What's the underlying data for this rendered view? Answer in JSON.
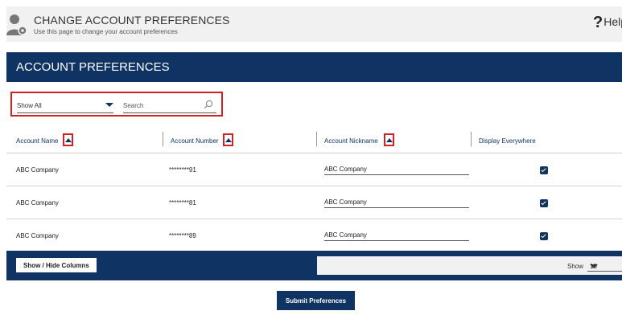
{
  "header": {
    "title": "CHANGE ACCOUNT PREFERENCES",
    "subtitle": "Use this page to change your account preferences",
    "help_label": "Help",
    "help_glyph": "?",
    "icon": "user-gear-icon"
  },
  "panel": {
    "title": "ACCOUNT PREFERENCES"
  },
  "filter": {
    "selected": "Show All",
    "search_placeholder": "Search"
  },
  "columns": {
    "name": "Account Name",
    "number": "Account Number",
    "nickname": "Account Nickname",
    "display": "Display Everywhere"
  },
  "rows": [
    {
      "name": "ABC Company",
      "number": "********91",
      "nickname": "ABC Company",
      "display": true
    },
    {
      "name": "ABC Company",
      "number": "********81",
      "nickname": "ABC Company",
      "display": true
    },
    {
      "name": "ABC Company",
      "number": "********89",
      "nickname": "ABC Company",
      "display": true
    }
  ],
  "footer": {
    "show_hide_label": "Show / Hide Columns",
    "show_label": "Show",
    "page_size": "10"
  },
  "submit_label": "Submit Preferences",
  "colors": {
    "navy": "#0f3362",
    "highlight_red": "#d42020",
    "header_gray": "#f1f1f1"
  }
}
